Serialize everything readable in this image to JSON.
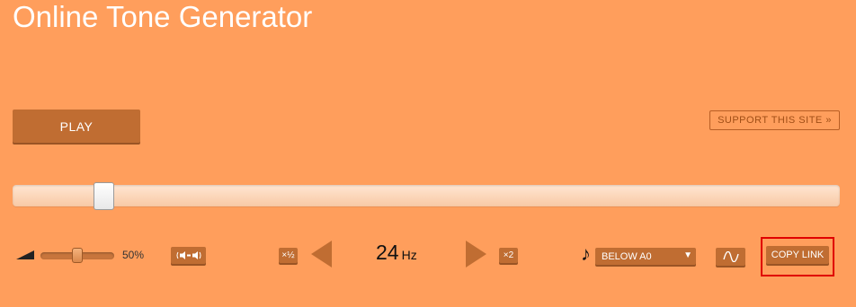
{
  "header": {
    "title": "Online Tone Generator"
  },
  "controls": {
    "play_label": "PLAY",
    "support_label": "SUPPORT THIS SITE »",
    "frequency_slider_position": 0.1
  },
  "volume": {
    "percent_label": "50%",
    "level": 0.5
  },
  "balance": {
    "icon": "balance-speakers-icon"
  },
  "frequency": {
    "half_label": "×½",
    "double_label": "×2",
    "value": "24",
    "unit": "Hz"
  },
  "note": {
    "icon": "music-note-icon",
    "symbol": "♪",
    "selected": "BELOW A0"
  },
  "waveform": {
    "icon": "sine-wave-icon"
  },
  "share": {
    "copy_link_label": "COPY LINK"
  },
  "colors": {
    "background": "#FF9E5C",
    "button": "#C06D32",
    "highlight_box": "#E00000"
  }
}
